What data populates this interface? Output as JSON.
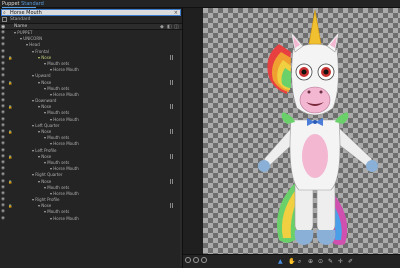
{
  "tab": {
    "title": "Puppet",
    "subtitle": "Standard"
  },
  "search": {
    "value": "Horse Mouth"
  },
  "source": {
    "label": "Standard"
  },
  "header": {
    "name_label": "Name"
  },
  "tree": [
    {
      "label": "PUPPET",
      "indent": 0,
      "lock": false
    },
    {
      "label": "UNICORN",
      "indent": 1,
      "lock": false
    },
    {
      "label": "Head",
      "indent": 2,
      "lock": false
    },
    {
      "label": "Frontal",
      "indent": 3,
      "lock": false
    },
    {
      "label": "Nose",
      "indent": 4,
      "lock": true,
      "hl": true
    },
    {
      "label": "Mouth sets",
      "indent": 5,
      "lock": false
    },
    {
      "label": "Horse Mouth",
      "indent": 6,
      "lock": false
    },
    {
      "label": "Upward",
      "indent": 3,
      "lock": false
    },
    {
      "label": "Nose",
      "indent": 4,
      "lock": true
    },
    {
      "label": "Mouth sets",
      "indent": 5,
      "lock": false
    },
    {
      "label": "Horse Mouth",
      "indent": 6,
      "lock": false
    },
    {
      "label": "Downward",
      "indent": 3,
      "lock": false
    },
    {
      "label": "Nose",
      "indent": 4,
      "lock": true
    },
    {
      "label": "Mouth sets",
      "indent": 5,
      "lock": false
    },
    {
      "label": "Horse Mouth",
      "indent": 6,
      "lock": false
    },
    {
      "label": "Left Quarter",
      "indent": 3,
      "lock": false
    },
    {
      "label": "Nose",
      "indent": 4,
      "lock": true
    },
    {
      "label": "Mouth sets",
      "indent": 5,
      "lock": false
    },
    {
      "label": "Horse Mouth",
      "indent": 6,
      "lock": false
    },
    {
      "label": "Left Profile",
      "indent": 3,
      "lock": false
    },
    {
      "label": "Nose",
      "indent": 4,
      "lock": true
    },
    {
      "label": "Mouth sets",
      "indent": 5,
      "lock": false
    },
    {
      "label": "Horse Mouth",
      "indent": 6,
      "lock": false
    },
    {
      "label": "Right Quarter",
      "indent": 3,
      "lock": false
    },
    {
      "label": "Nose",
      "indent": 4,
      "lock": true
    },
    {
      "label": "Mouth sets",
      "indent": 5,
      "lock": false
    },
    {
      "label": "Horse Mouth",
      "indent": 6,
      "lock": false
    },
    {
      "label": "Right Profile",
      "indent": 3,
      "lock": false
    },
    {
      "label": "Nose",
      "indent": 4,
      "lock": true
    },
    {
      "label": "Mouth sets",
      "indent": 5,
      "lock": false
    },
    {
      "label": "Horse Mouth",
      "indent": 6,
      "lock": false
    }
  ],
  "colors": {
    "accent": "#4a8ee0",
    "body": "#f4f4f4",
    "cheek": "#f3b7d2"
  }
}
